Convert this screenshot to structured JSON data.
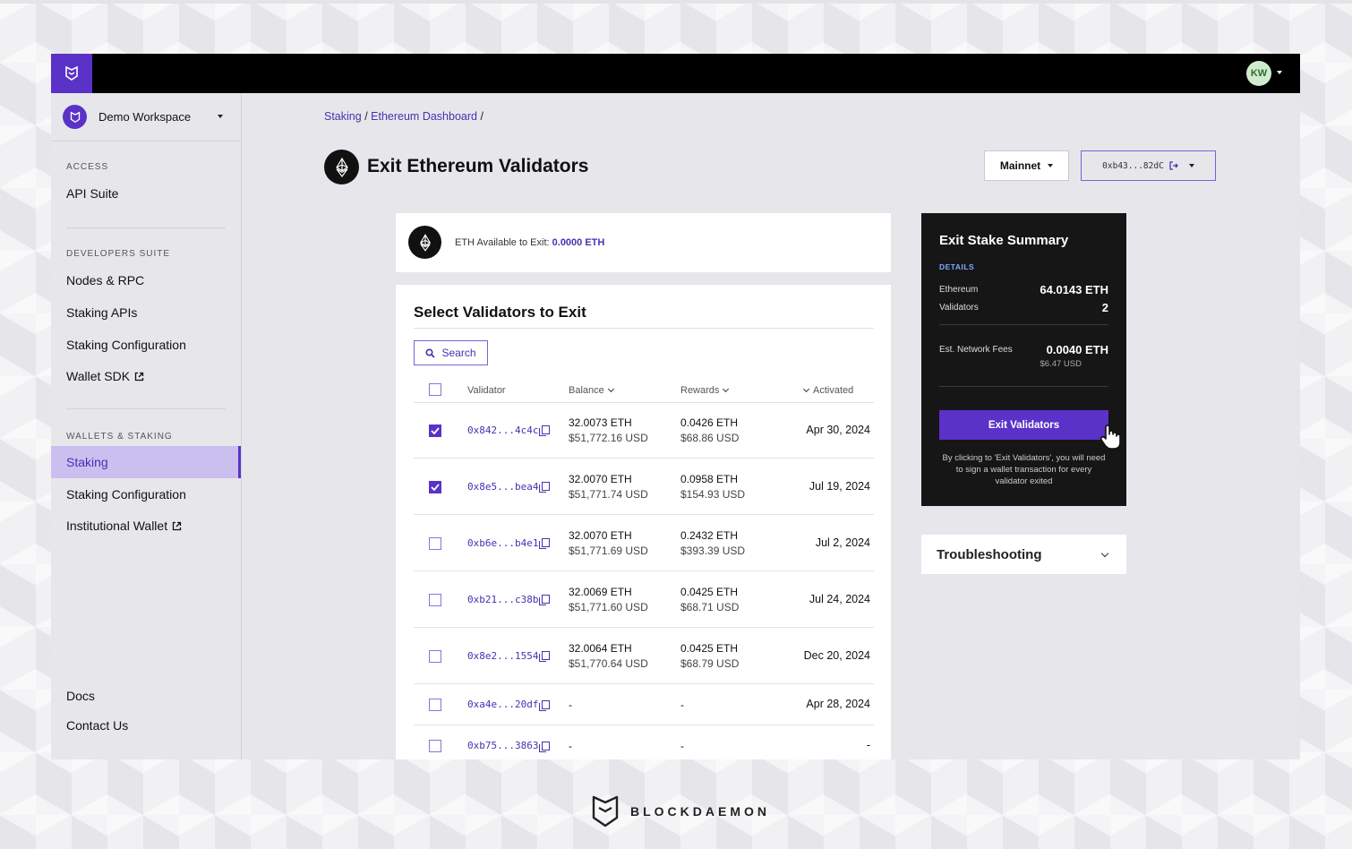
{
  "topbar": {
    "avatar_initials": "KW"
  },
  "workspace": {
    "name": "Demo Workspace"
  },
  "sidebar": {
    "sections": [
      {
        "title": "ACCESS",
        "items": [
          {
            "label": "API Suite"
          }
        ]
      },
      {
        "title": "DEVELOPERS SUITE",
        "items": [
          {
            "label": "Nodes & RPC"
          },
          {
            "label": "Staking APIs"
          },
          {
            "label": "Staking Configuration"
          },
          {
            "label": "Wallet SDK",
            "external": true
          }
        ]
      },
      {
        "title": "WALLETS & STAKING",
        "items": [
          {
            "label": "Staking",
            "active": true
          },
          {
            "label": "Staking Configuration"
          },
          {
            "label": "Institutional Wallet",
            "external": true
          }
        ]
      }
    ],
    "footer": [
      {
        "label": "Docs"
      },
      {
        "label": "Contact Us"
      }
    ]
  },
  "breadcrumb": {
    "items": [
      "Staking",
      "Ethereum Dashboard"
    ],
    "separator": "/"
  },
  "page": {
    "title": "Exit Ethereum Validators"
  },
  "network": {
    "selected": "Mainnet"
  },
  "wallet": {
    "address": "0xb43...82dC"
  },
  "available": {
    "label": "ETH Available to Exit:",
    "value": "0.0000 ETH"
  },
  "validators": {
    "title": "Select Validators to Exit",
    "search_label": "Search",
    "columns": {
      "validator": "Validator",
      "balance": "Balance",
      "rewards": "Rewards",
      "activated": "Activated"
    },
    "rows": [
      {
        "checked": true,
        "address": "0x842...4c4c",
        "balance_eth": "32.0073 ETH",
        "balance_usd": "$51,772.16 USD",
        "rewards_eth": "0.0426 ETH",
        "rewards_usd": "$68.86 USD",
        "activated": "Apr 30, 2024"
      },
      {
        "checked": true,
        "address": "0x8e5...bea4",
        "balance_eth": "32.0070 ETH",
        "balance_usd": "$51,771.74 USD",
        "rewards_eth": "0.0958 ETH",
        "rewards_usd": "$154.93 USD",
        "activated": "Jul 19, 2024"
      },
      {
        "checked": false,
        "address": "0xb6e...b4e1",
        "balance_eth": "32.0070 ETH",
        "balance_usd": "$51,771.69 USD",
        "rewards_eth": "0.2432 ETH",
        "rewards_usd": "$393.39 USD",
        "activated": "Jul 2, 2024"
      },
      {
        "checked": false,
        "address": "0xb21...c38b",
        "balance_eth": "32.0069 ETH",
        "balance_usd": "$51,771.60 USD",
        "rewards_eth": "0.0425 ETH",
        "rewards_usd": "$68.71 USD",
        "activated": "Jul 24, 2024"
      },
      {
        "checked": false,
        "address": "0x8e2...1554",
        "balance_eth": "32.0064 ETH",
        "balance_usd": "$51,770.64 USD",
        "rewards_eth": "0.0425 ETH",
        "rewards_usd": "$68.79 USD",
        "activated": "Dec 20, 2024"
      },
      {
        "checked": false,
        "address": "0xa4e...20df",
        "balance_eth": "-",
        "balance_usd": "",
        "rewards_eth": "-",
        "rewards_usd": "",
        "activated": "Apr 28, 2024"
      },
      {
        "checked": false,
        "address": "0xb75...3863",
        "balance_eth": "-",
        "balance_usd": "",
        "rewards_eth": "-",
        "rewards_usd": "",
        "activated": "-"
      }
    ]
  },
  "summary": {
    "title": "Exit Stake Summary",
    "details_label": "DETAILS",
    "ethereum_label": "Ethereum",
    "ethereum_value": "64.0143 ETH",
    "validators_label": "Validators",
    "validators_value": "2",
    "fees_label": "Est. Network Fees",
    "fees_value": "0.0040 ETH",
    "fees_usd": "$6.47 USD",
    "button_label": "Exit Validators",
    "note": "By clicking to 'Exit Validators', you will need to sign a wallet transaction for every validator exited"
  },
  "troubleshooting": {
    "label": "Troubleshooting"
  },
  "brand": {
    "name": "BLOCKDAEMON"
  },
  "colors": {
    "accent": "#5a32c8",
    "accent_text": "#4b2fb0",
    "active_bg": "#cbbff0",
    "summary_bg": "#161616"
  }
}
